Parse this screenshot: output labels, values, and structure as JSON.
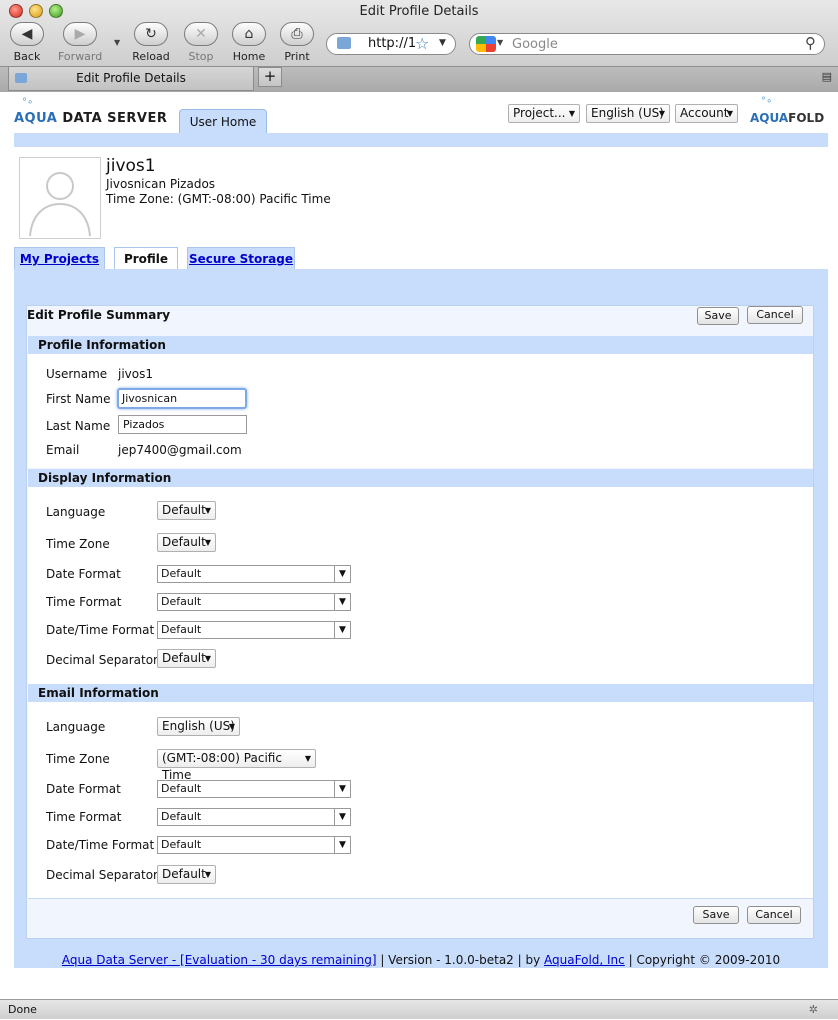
{
  "browser": {
    "window_title": "Edit Profile Details",
    "toolbar": {
      "back": "Back",
      "forward": "Forward",
      "reload": "Reload",
      "stop": "Stop",
      "home": "Home",
      "print": "Print"
    },
    "address": "http://1",
    "search_placeholder": "Google",
    "tab_title": "Edit Profile Details",
    "new_tab": "+",
    "status": "Done"
  },
  "header": {
    "brand_aqua": "AQUA",
    "brand_ds": "DATA SERVER",
    "tab_user_home": "User Home",
    "menu_project": "Project...",
    "menu_language": "English (US)",
    "menu_account": "Account",
    "logo_aqua": "AQUA",
    "logo_fold": "FOLD"
  },
  "profile": {
    "username": "jivos1",
    "full_name": "Jivosnican Pizados",
    "time_zone": "Time Zone: (GMT:-08:00) Pacific Time"
  },
  "tabs": [
    "My Projects",
    "Profile",
    "Secure Storage"
  ],
  "panel": {
    "title": "Edit Profile Summary",
    "save": "Save",
    "cancel": "Cancel"
  },
  "profile_info": {
    "heading": "Profile Information",
    "username_label": "Username",
    "username_value": "jivos1",
    "first_name_label": "First Name",
    "first_name_value": "Jivosnican",
    "last_name_label": "Last Name",
    "last_name_value": "Pizados",
    "email_label": "Email",
    "email_value": "jep7400@gmail.com"
  },
  "display_info": {
    "heading": "Display Information",
    "language_label": "Language",
    "language_value": "Default",
    "timezone_label": "Time Zone",
    "timezone_value": "Default",
    "date_format_label": "Date Format",
    "date_format_value": "Default",
    "time_format_label": "Time Format",
    "time_format_value": "Default",
    "datetime_format_label": "Date/Time Format",
    "datetime_format_value": "Default",
    "decimal_label": "Decimal Separator",
    "decimal_value": "Default"
  },
  "email_info": {
    "heading": "Email Information",
    "language_label": "Language",
    "language_value": "English (US)",
    "timezone_label": "Time Zone",
    "timezone_value": "(GMT:-08:00) Pacific Time",
    "date_format_label": "Date Format",
    "date_format_value": "Default",
    "time_format_label": "Time Format",
    "time_format_value": "Default",
    "datetime_format_label": "Date/Time Format",
    "datetime_format_value": "Default",
    "decimal_label": "Decimal Separator",
    "decimal_value": "Default"
  },
  "footer": {
    "link_eval": "Aqua Data Server - [Evaluation - 30 days remaining]",
    "sep1": " | ",
    "version": "Version - 1.0.0-beta2",
    "sep2": " | by ",
    "link_company": "AquaFold, Inc",
    "copyright": " | Copyright © 2009-2010"
  },
  "colors": {
    "accent_blue": "#c8dcfb",
    "link": "#0000cc",
    "brand": "#2a6fb5"
  }
}
